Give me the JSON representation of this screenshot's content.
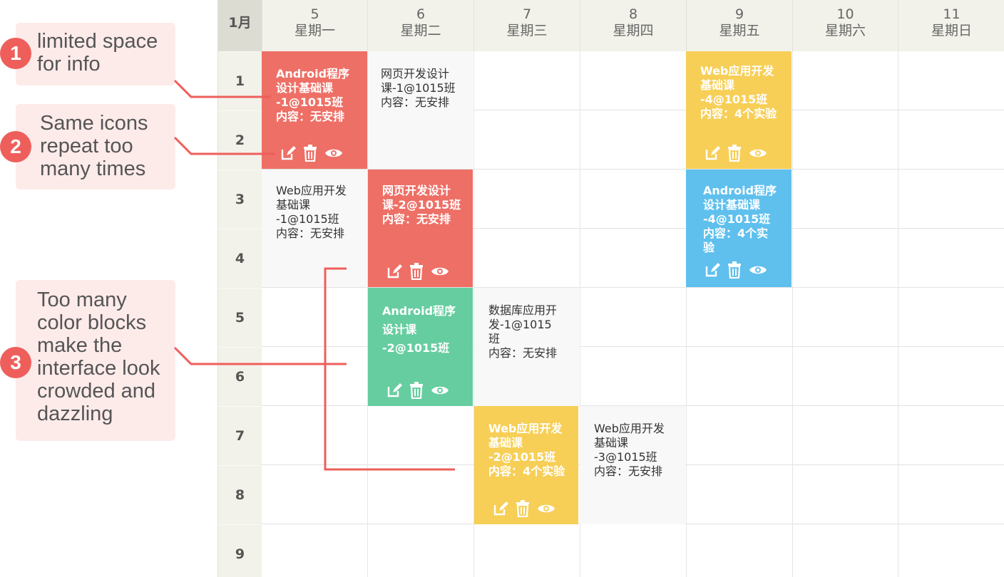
{
  "annotations": [
    {
      "number": "1",
      "lines": [
        "limited space",
        "for info"
      ]
    },
    {
      "number": "2",
      "lines": [
        "Same icons",
        "repeat too",
        "many times"
      ]
    },
    {
      "number": "3",
      "lines": [
        "Too many",
        "color blocks",
        "make the",
        "interface look",
        "crowded and",
        "dazzling"
      ]
    }
  ],
  "calendar": {
    "month": "1月",
    "days": [
      {
        "num": "5",
        "weekday": "星期一"
      },
      {
        "num": "6",
        "weekday": "星期二"
      },
      {
        "num": "7",
        "weekday": "星期三"
      },
      {
        "num": "8",
        "weekday": "星期四"
      },
      {
        "num": "9",
        "weekday": "星期五"
      },
      {
        "num": "10",
        "weekday": "星期六"
      },
      {
        "num": "11",
        "weekday": "星期日"
      }
    ],
    "periods": [
      "1",
      "2",
      "3",
      "4",
      "5",
      "6",
      "7",
      "8",
      "9"
    ],
    "events": [
      {
        "lines": [
          "Android程序",
          "设计基础课",
          "-1@1015班",
          "内容：无安排"
        ],
        "color": "#ee6f66",
        "style": "red",
        "icons": [
          "edit-icon",
          "trash-icon",
          "eye-icon"
        ]
      },
      {
        "lines": [
          "网页开发设计",
          "课-1@1015班",
          "内容：无安排"
        ],
        "color": "#f8f8f8",
        "style": "plain"
      },
      {
        "lines": [
          "Web应用开发",
          "基础课",
          "-4@1015班",
          "内容：4个实验"
        ],
        "color": "#f7cf57",
        "style": "yellow",
        "icons": [
          "edit-icon",
          "trash-icon",
          "eye-icon"
        ]
      },
      {
        "lines": [
          "Web应用开发",
          "基础课",
          "-1@1015班",
          "内容：无安排"
        ],
        "color": "#f8f8f8",
        "style": "plain"
      },
      {
        "lines": [
          "网页开发设计",
          "课-2@1015班",
          "内容：无安排"
        ],
        "color": "#ee6f66",
        "style": "red",
        "icons": [
          "edit-icon",
          "trash-icon",
          "eye-icon"
        ]
      },
      {
        "lines": [
          "Android程序",
          "设计基础课",
          "-4@1015班",
          "内容：4个实",
          "验"
        ],
        "color": "#5fc0ee",
        "style": "blue",
        "icons": [
          "edit-icon",
          "trash-icon",
          "eye-icon"
        ]
      },
      {
        "lines": [
          "Android程序",
          "设计课",
          "-2@1015班"
        ],
        "color": "#66cda0",
        "style": "green",
        "icons": [
          "edit-icon",
          "trash-icon",
          "eye-icon"
        ]
      },
      {
        "lines": [
          "数据库应用开",
          "发-1@1015",
          "班",
          "内容：无安排"
        ],
        "color": "#f8f8f8",
        "style": "plain"
      },
      {
        "lines": [
          "Web应用开发",
          "基础课",
          "-2@1015班",
          "内容：4个实验"
        ],
        "color": "#f7cf57",
        "style": "yellow",
        "icons": [
          "edit-icon",
          "trash-icon",
          "eye-icon"
        ]
      },
      {
        "lines": [
          "Web应用开发",
          "基础课",
          "-3@1015班",
          "内容：无安排"
        ],
        "color": "#f8f8f8",
        "style": "plain"
      }
    ]
  },
  "colors": {
    "accent_red": "#ee5f5b",
    "callout_bg": "#fdebea",
    "header_bg": "#f2f2ea"
  }
}
